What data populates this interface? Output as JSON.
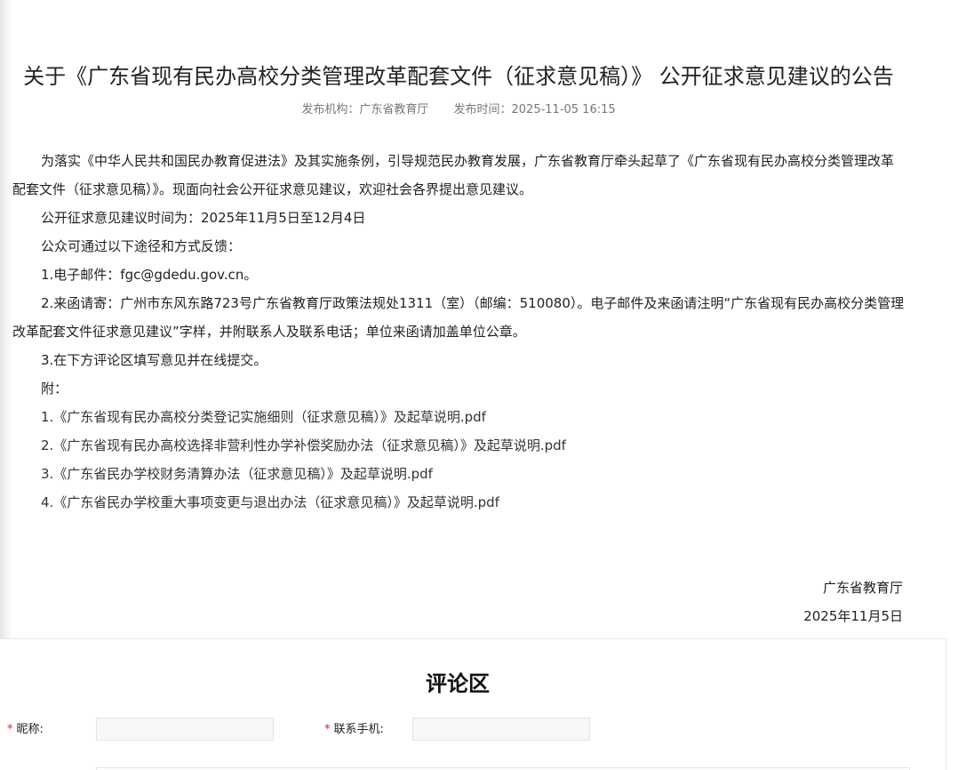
{
  "article": {
    "title": "关于《广东省现有民办高校分类管理改革配套文件（征求意见稿）》 公开征求意见建议的公告",
    "publisher": "发布机构：广东省教育厅",
    "publish_time": "发布时间：2025-11-05 16:15",
    "paragraphs": [
      "为落实《中华人民共和国民办教育促进法》及其实施条例，引导规范民办教育发展，广东省教育厅牵头起草了《广东省现有民办高校分类管理改革配套文件（征求意见稿）》。现面向社会公开征求意见建议，欢迎社会各界提出意见建议。",
      "公开征求意见建议时间为：2025年11月5日至12月4日",
      "公众可通过以下途径和方式反馈：",
      "1.电子邮件：fgc@gdedu.gov.cn。",
      "2.来函请寄：广州市东风东路723号广东省教育厅政策法规处1311（室）（邮编：510080）。电子邮件及来函请注明“广东省现有民办高校分类管理改革配套文件征求意见建议”字样，并附联系人及联系电话；单位来函请加盖单位公章。",
      "3.在下方评论区填写意见并在线提交。",
      "附："
    ],
    "attachments": [
      "1.《广东省现有民办高校分类登记实施细则（征求意见稿）》及起草说明.pdf",
      "2.《广东省现有民办高校选择非营利性办学补偿奖励办法（征求意见稿）》及起草说明.pdf",
      "3.《广东省民办学校财务清算办法（征求意见稿）》及起草说明.pdf",
      "4.《广东省民办学校重大事项变更与退出办法（征求意见稿）》及起草说明.pdf"
    ],
    "signature_org": "广东省教育厅",
    "signature_date": "2025年11月5日"
  },
  "comments": {
    "title": "评论区",
    "required_mark": "*",
    "nickname_label": "昵称:",
    "phone_label": "联系手机:",
    "nickname_value": "",
    "phone_value": ""
  },
  "colors": {
    "required": "#e02020",
    "meta_text": "#777777"
  }
}
